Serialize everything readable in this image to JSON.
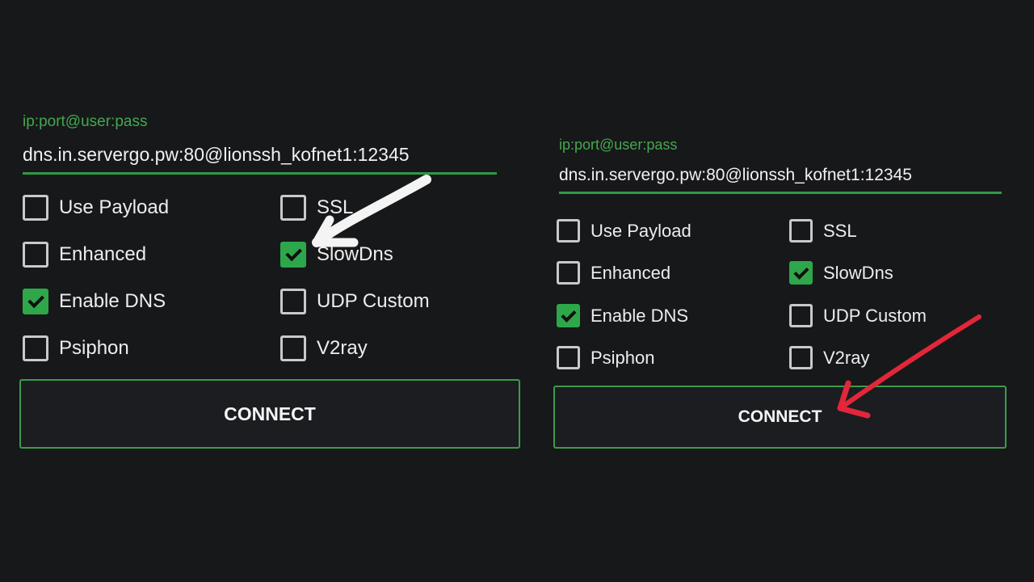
{
  "panels": [
    {
      "field_label": "ip:port@user:pass",
      "field_value": "dns.in.servergo.pw:80@lionssh_kofnet1:12345",
      "options": [
        {
          "label": "Use Payload",
          "checked": false
        },
        {
          "label": "SSL",
          "checked": false
        },
        {
          "label": "Enhanced",
          "checked": false
        },
        {
          "label": "SlowDns",
          "checked": true
        },
        {
          "label": "Enable DNS",
          "checked": true
        },
        {
          "label": "UDP Custom",
          "checked": false
        },
        {
          "label": "Psiphon",
          "checked": false
        },
        {
          "label": "V2ray",
          "checked": false
        }
      ],
      "connect_label": "CONNECT"
    },
    {
      "field_label": "ip:port@user:pass",
      "field_value": "dns.in.servergo.pw:80@lionssh_kofnet1:12345",
      "options": [
        {
          "label": "Use Payload",
          "checked": false
        },
        {
          "label": "SSL",
          "checked": false
        },
        {
          "label": "Enhanced",
          "checked": false
        },
        {
          "label": "SlowDns",
          "checked": true
        },
        {
          "label": "Enable DNS",
          "checked": true
        },
        {
          "label": "UDP Custom",
          "checked": false
        },
        {
          "label": "Psiphon",
          "checked": false
        },
        {
          "label": "V2ray",
          "checked": false
        }
      ],
      "connect_label": "CONNECT"
    }
  ],
  "colors": {
    "background": "#17181a",
    "accent_green": "#2ea74a",
    "label_green": "#43a84f",
    "white_arrow": "#f4f4f4",
    "red_arrow": "#e3263a"
  },
  "annotations": [
    {
      "icon": "white-arrow-icon",
      "points_to": "SlowDns"
    },
    {
      "icon": "red-arrow-icon",
      "points_to": "CONNECT"
    }
  ]
}
